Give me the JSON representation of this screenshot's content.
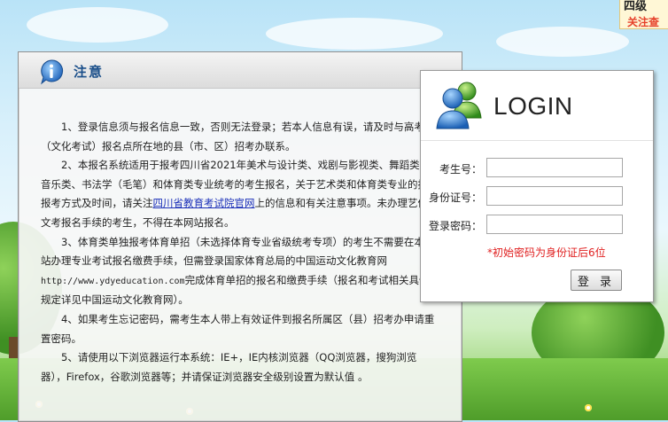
{
  "banner": {
    "line1": "四级",
    "line2": "关注查"
  },
  "notice": {
    "title": "注意",
    "paragraphs": [
      "1、登录信息须与报名信息一致，否则无法登录；若本人信息有误，请及时与高考（文化考试）报名点所在地的县（市、区）招考办联系。",
      "4、如果考生忘记密码，需考生本人带上有效证件到报名所属区（县）招考办申请重置密码。",
      "5、请使用以下浏览器运行本系统：IE+，IE内核浏览器（QQ浏览器，搜狗浏览器），Firefox，谷歌浏览器等；并请保证浏览器安全级别设置为默认值 。"
    ],
    "p2_before": "2、本报名系统适用于报考四川省2021年美术与设计类、戏剧与影视类、舞蹈类、音乐类、书法学（毛笔）和体育类专业统考的考生报名，关于艺术类和体育类专业的报名报考方式及时间，请关注",
    "p2_link": "四川省教育考试院官网",
    "p2_after": "上的信息和有关注意事项。未办理艺体类文考报名手续的考生，不得在本网站报名。",
    "p3_before": "3、体育类单独报考体育单招（未选择体育专业省级统考专项）的考生不需要在本网站办理专业考试报名缴费手续，但需登录国家体育总局的中国运动文化教育网",
    "p3_url": "http://www.ydyeducation.com",
    "p3_after": "完成体育单招的报名和缴费手续（报名和考试相关具体规定详见中国运动文化教育网）。"
  },
  "login": {
    "title": "LOGIN",
    "fields": [
      {
        "label": "考生号：",
        "value": ""
      },
      {
        "label": "身份证号：",
        "value": ""
      },
      {
        "label": "登录密码：",
        "value": ""
      }
    ],
    "hint": "*初始密码为身份证后6位",
    "button": "登 录"
  },
  "icons": {
    "info": "info-icon",
    "users": "users-icon"
  },
  "colors": {
    "title_blue": "#1b4f8a",
    "hint_red": "#e02020",
    "link_blue": "#1a2fb8"
  }
}
